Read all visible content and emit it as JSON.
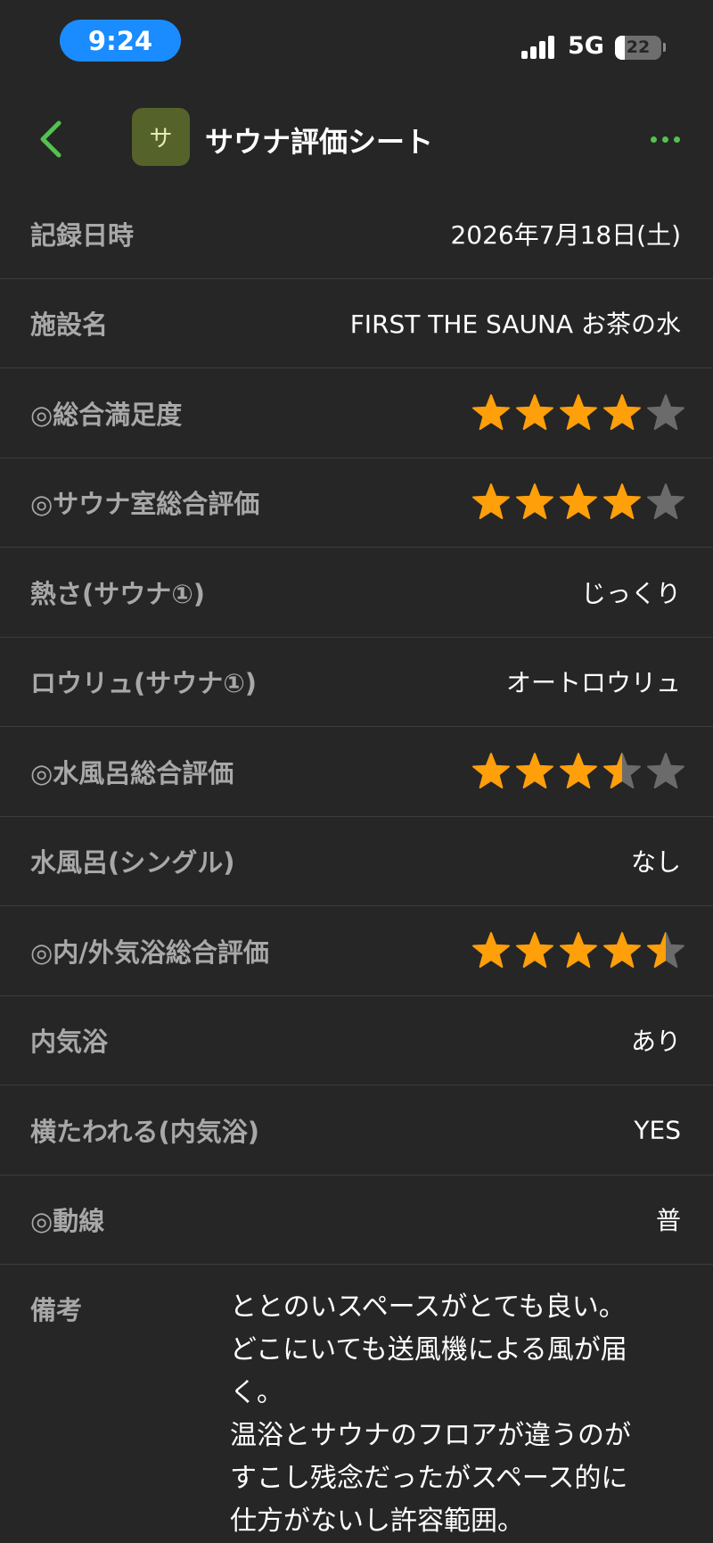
{
  "status_bar": {
    "time": "9:24",
    "network": "5G",
    "battery_level": "22",
    "battery_fraction": 0.22
  },
  "nav": {
    "app_icon_glyph": "サ",
    "title": "サウナ評価シート",
    "back_icon": "chevron-left-icon",
    "more_icon": "more-horizontal-icon",
    "accent_color": "#53c24e"
  },
  "rows": [
    {
      "label": "記録日時",
      "value": "2026年7月18日(土)"
    },
    {
      "label": "施設名",
      "value": "FIRST THE SAUNA お茶の水"
    },
    {
      "label": "◎総合満足度",
      "rating": 4
    },
    {
      "label": "◎サウナ室総合評価",
      "rating": 4
    },
    {
      "label": "熱さ(サウナ①)",
      "value": "じっくり"
    },
    {
      "label": "ロウリュ(サウナ①)",
      "value": "オートロウリュ"
    },
    {
      "label": "◎水風呂総合評価",
      "rating": 3.5
    },
    {
      "label": "水風呂(シングル)",
      "value": "なし"
    },
    {
      "label": "◎内/外気浴総合評価",
      "rating": 4.5
    },
    {
      "label": "内気浴",
      "value": "あり"
    },
    {
      "label": "横たわれる(内気浴)",
      "value": "YES"
    },
    {
      "label": "◎動線",
      "value": "普"
    }
  ],
  "notes": {
    "label": "備考",
    "lines": [
      "ととのいスペースがとても良い。",
      "どこにいても送風機による風が届",
      "く。",
      "温浴とサウナのフロアが違うのが",
      "すこし残念だったがスペース的に",
      "仕方がないし許容範囲。"
    ]
  },
  "colors": {
    "star_filled": "#ff9f0a",
    "star_empty": "#6b6b6b",
    "background": "#262626"
  }
}
